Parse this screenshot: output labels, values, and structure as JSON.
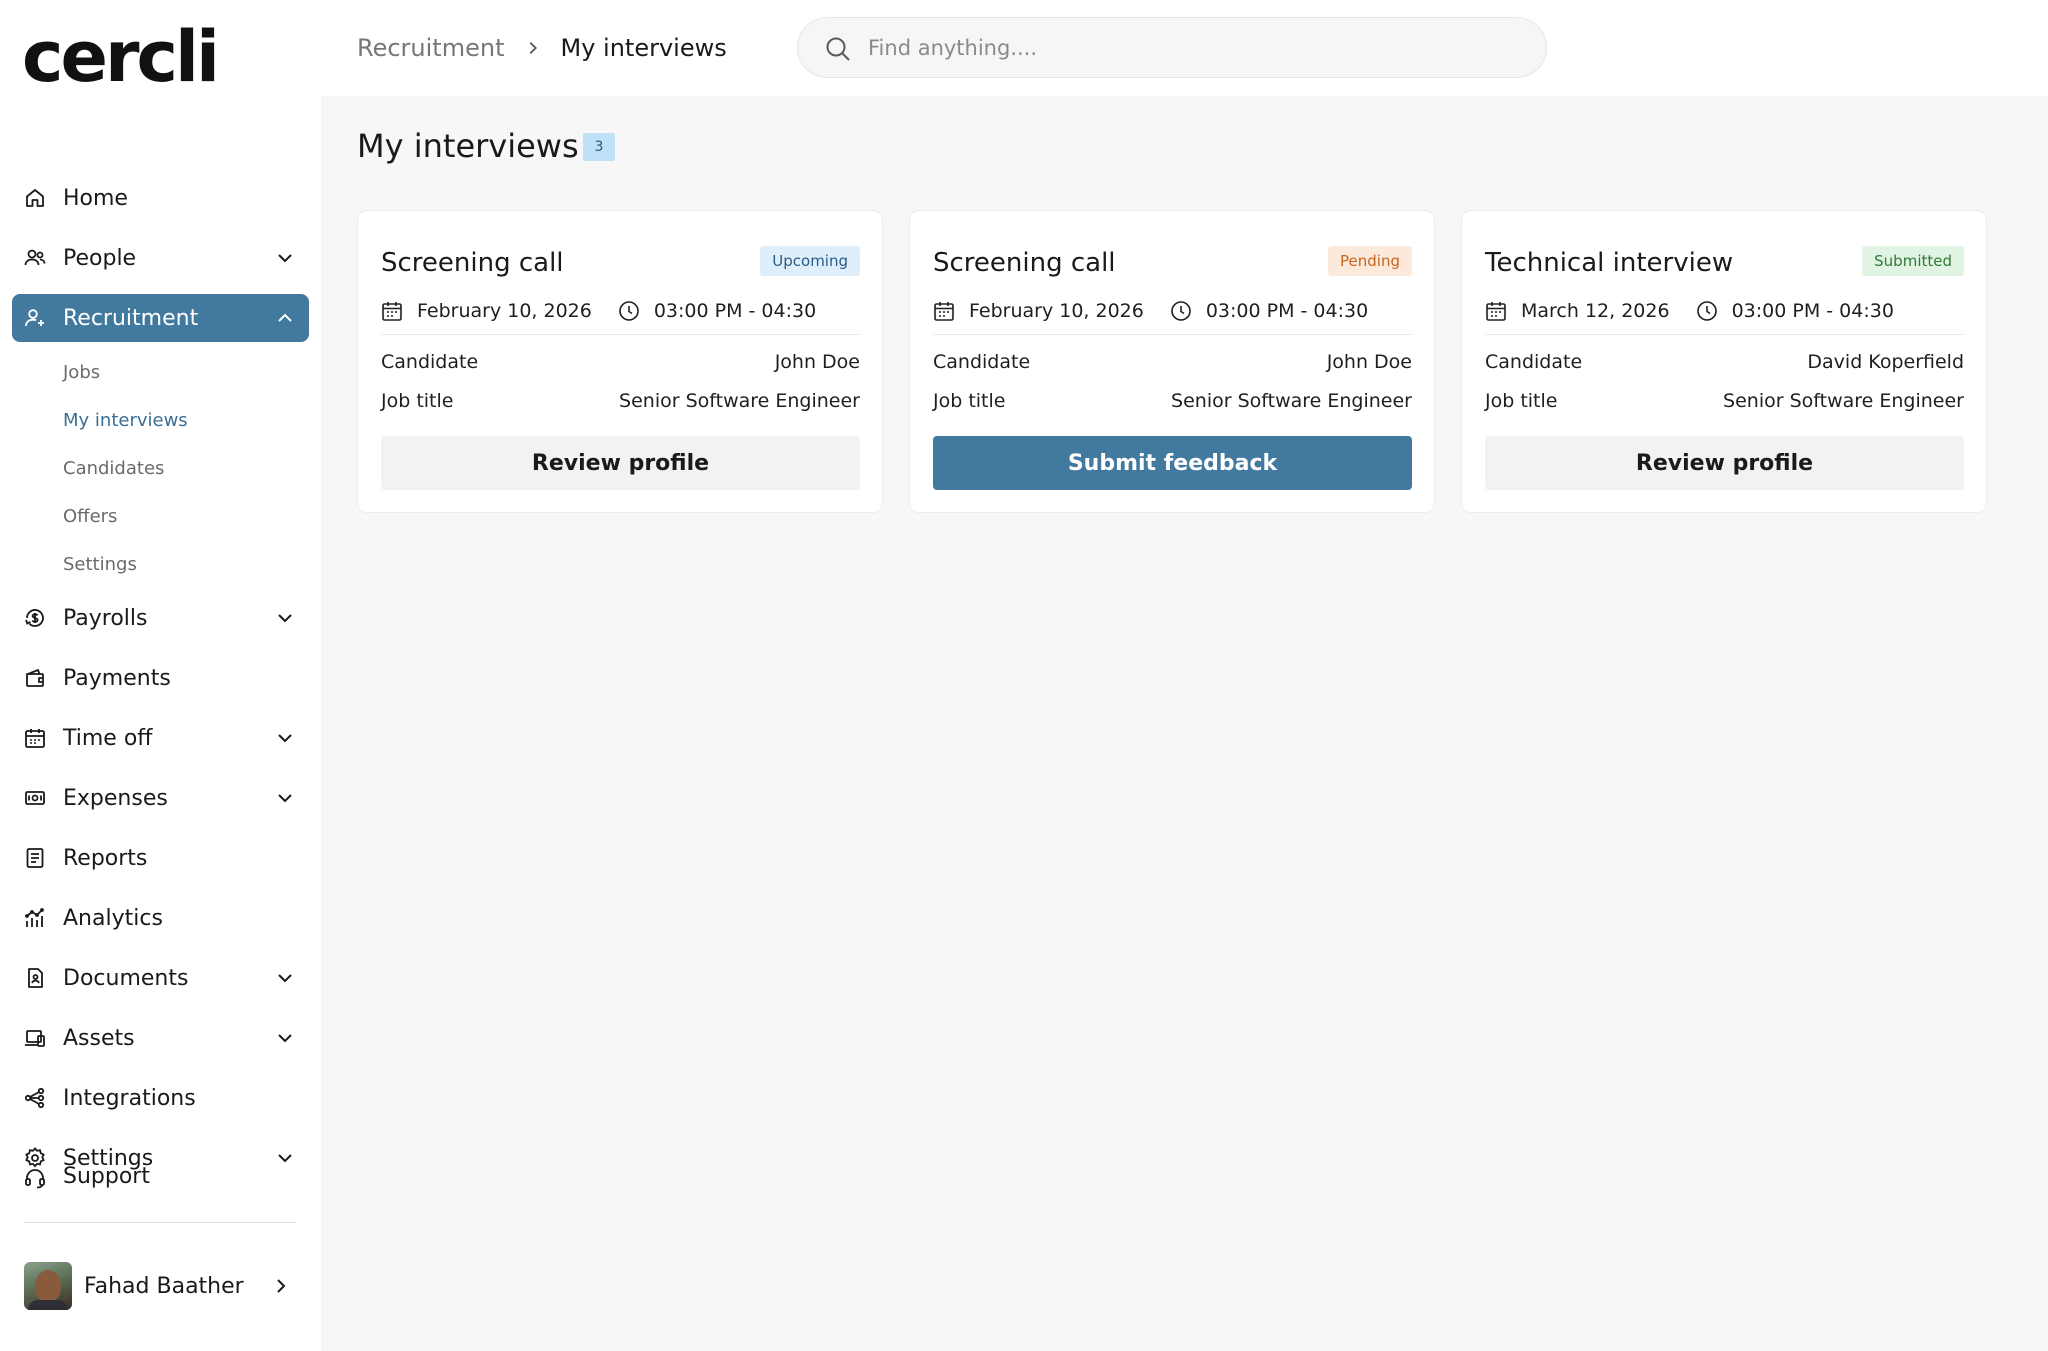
{
  "brand": {
    "logo_text": "cercli",
    "accent": "#41799f"
  },
  "sidebar": {
    "items": [
      {
        "label": "Home",
        "icon": "home-icon",
        "has_chevron": false
      },
      {
        "label": "People",
        "icon": "people-icon",
        "has_chevron": true
      },
      {
        "label": "Recruitment",
        "icon": "recruitment-icon",
        "has_chevron": true,
        "active": true,
        "expanded": true,
        "children": [
          "Jobs",
          "My interviews",
          "Candidates",
          "Offers",
          "Settings"
        ]
      },
      {
        "label": "Payrolls",
        "icon": "payrolls-icon",
        "has_chevron": true
      },
      {
        "label": "Payments",
        "icon": "wallet-icon",
        "has_chevron": false
      },
      {
        "label": "Time off",
        "icon": "calendar-icon",
        "has_chevron": true
      },
      {
        "label": "Expenses",
        "icon": "expenses-icon",
        "has_chevron": true
      },
      {
        "label": "Reports",
        "icon": "reports-icon",
        "has_chevron": false
      },
      {
        "label": "Analytics",
        "icon": "analytics-icon",
        "has_chevron": false
      },
      {
        "label": "Documents",
        "icon": "documents-icon",
        "has_chevron": true
      },
      {
        "label": "Assets",
        "icon": "assets-icon",
        "has_chevron": true
      },
      {
        "label": "Integrations",
        "icon": "integrations-icon",
        "has_chevron": false
      },
      {
        "label": "Settings",
        "icon": "gear-icon",
        "has_chevron": true
      },
      {
        "label": "Support",
        "icon": "support-icon",
        "has_chevron": false
      }
    ],
    "active_child": "My interviews",
    "user": {
      "name": "Fahad Baather"
    }
  },
  "header": {
    "breadcrumb": {
      "parent": "Recruitment",
      "current": "My interviews"
    },
    "search": {
      "placeholder": "Find anything...."
    }
  },
  "main": {
    "title": "My interviews",
    "count": "3",
    "cards": [
      {
        "title": "Screening call",
        "status": "Upcoming",
        "status_color": "#2a5c86",
        "date": "February 10, 2026",
        "time": "03:00 PM - 04:30",
        "candidate_label": "Candidate",
        "candidate": "John Doe",
        "job_label": "Job title",
        "job_title": "Senior Software Engineer",
        "action": "Review profile",
        "action_style": "secondary"
      },
      {
        "title": "Screening call",
        "status": "Pending",
        "status_color": "#c9641f",
        "date": "February 10, 2026",
        "time": "03:00 PM - 04:30",
        "candidate_label": "Candidate",
        "candidate": "John Doe",
        "job_label": "Job title",
        "job_title": "Senior Software Engineer",
        "action": "Submit feedback",
        "action_style": "primary"
      },
      {
        "title": "Technical interview",
        "status": "Submitted",
        "status_color": "#2e7a36",
        "date": "March 12, 2026",
        "time": "03:00 PM - 04:30",
        "candidate_label": "Candidate",
        "candidate": "David Koperfield",
        "job_label": "Job title",
        "job_title": "Senior Software Engineer",
        "action": "Review profile",
        "action_style": "secondary"
      }
    ]
  }
}
